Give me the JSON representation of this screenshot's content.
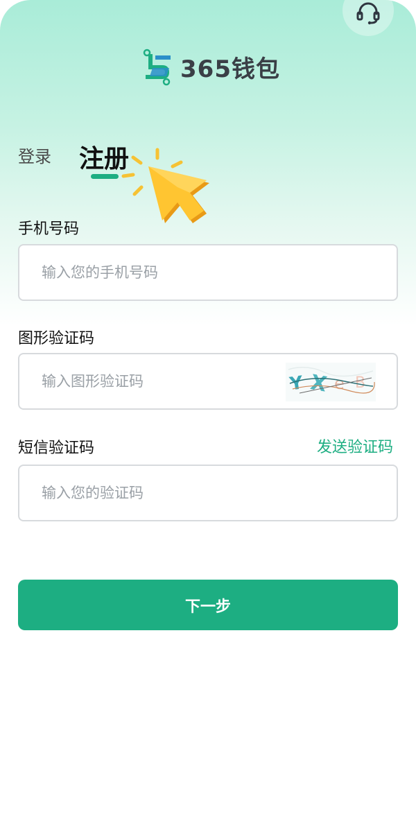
{
  "header": {
    "support_icon": "headset-icon",
    "brand": "365钱包",
    "logo_icon": "wallet-logo-icon"
  },
  "tabs": {
    "login": "登录",
    "register": "注册",
    "active": "register"
  },
  "form": {
    "phone": {
      "label": "手机号码",
      "placeholder": "输入您的手机号码",
      "value": ""
    },
    "captcha": {
      "label": "图形验证码",
      "placeholder": "输入图形验证码",
      "value": "",
      "image": "captcha-image"
    },
    "sms": {
      "label": "短信验证码",
      "placeholder": "输入您的验证码",
      "value": "",
      "send_label": "发送验证码"
    }
  },
  "actions": {
    "next_label": "下一步"
  },
  "colors": {
    "accent": "#1dae82",
    "text": "#111111",
    "placeholder": "#9aa0a6",
    "cursor": "#f6b92b"
  }
}
